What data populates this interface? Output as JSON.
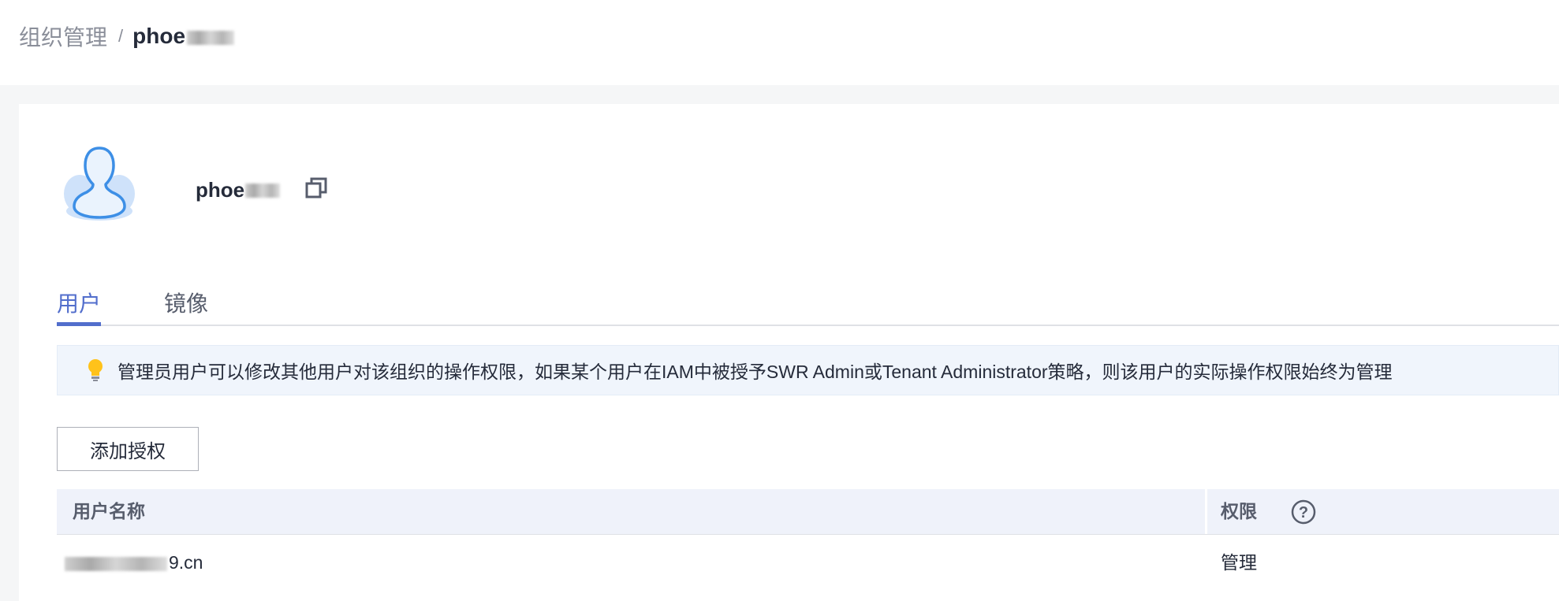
{
  "breadcrumb": {
    "parent": "组织管理",
    "separator": "/",
    "current_visible": "phoe"
  },
  "organization": {
    "name_visible": "phoe",
    "avatar_icon": "user-avatar-icon",
    "copy_icon": "copy-icon"
  },
  "tabs": [
    {
      "label": "用户",
      "active": true
    },
    {
      "label": "镜像",
      "active": false
    }
  ],
  "notice": {
    "icon": "lightbulb-icon",
    "text": "管理员用户可以修改其他用户对该组织的操作权限，如果某个用户在IAM中被授予SWR Admin或Tenant Administrator策略，则该用户的实际操作权限始终为管理"
  },
  "actions": {
    "add_permission_label": "添加授权"
  },
  "table": {
    "columns": [
      "用户名称",
      "权限"
    ],
    "help_icon": "question-circle-icon",
    "rows": [
      {
        "username_visible": "9.cn",
        "permission": "管理"
      }
    ]
  },
  "colors": {
    "accent": "#526ecc",
    "notice_bg": "#f0f5fc",
    "table_header_bg": "#eff2fa",
    "page_bg": "#f5f6f7"
  }
}
